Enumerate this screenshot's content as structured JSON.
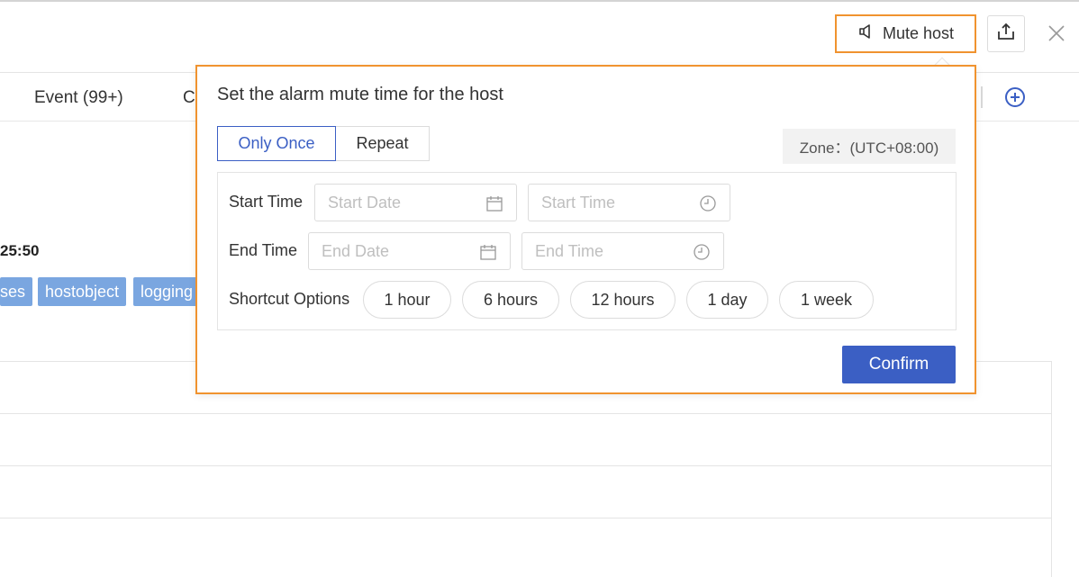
{
  "header": {
    "mute_label": "Mute host"
  },
  "tabs": [
    {
      "label": "Event (99+)"
    },
    {
      "label": "C"
    }
  ],
  "background": {
    "time": "25:50",
    "tags": [
      "ses",
      "hostobject",
      "logging"
    ]
  },
  "popover": {
    "title": "Set the alarm mute time for the host",
    "mode_once": "Only Once",
    "mode_repeat": "Repeat",
    "zone": "Zone：(UTC+08:00)",
    "start_label": "Start Time",
    "end_label": "End Time",
    "start_date_placeholder": "Start Date",
    "start_time_placeholder": "Start Time",
    "end_date_placeholder": "End Date",
    "end_time_placeholder": "End Time",
    "shortcut_label": "Shortcut Options",
    "shortcuts": [
      "1 hour",
      "6 hours",
      "12 hours",
      "1 day",
      "1 week"
    ],
    "confirm": "Confirm"
  },
  "colors": {
    "accent": "#3b5fc4",
    "highlight_border": "#f0932f",
    "tag_bg": "#7aa6e0"
  }
}
